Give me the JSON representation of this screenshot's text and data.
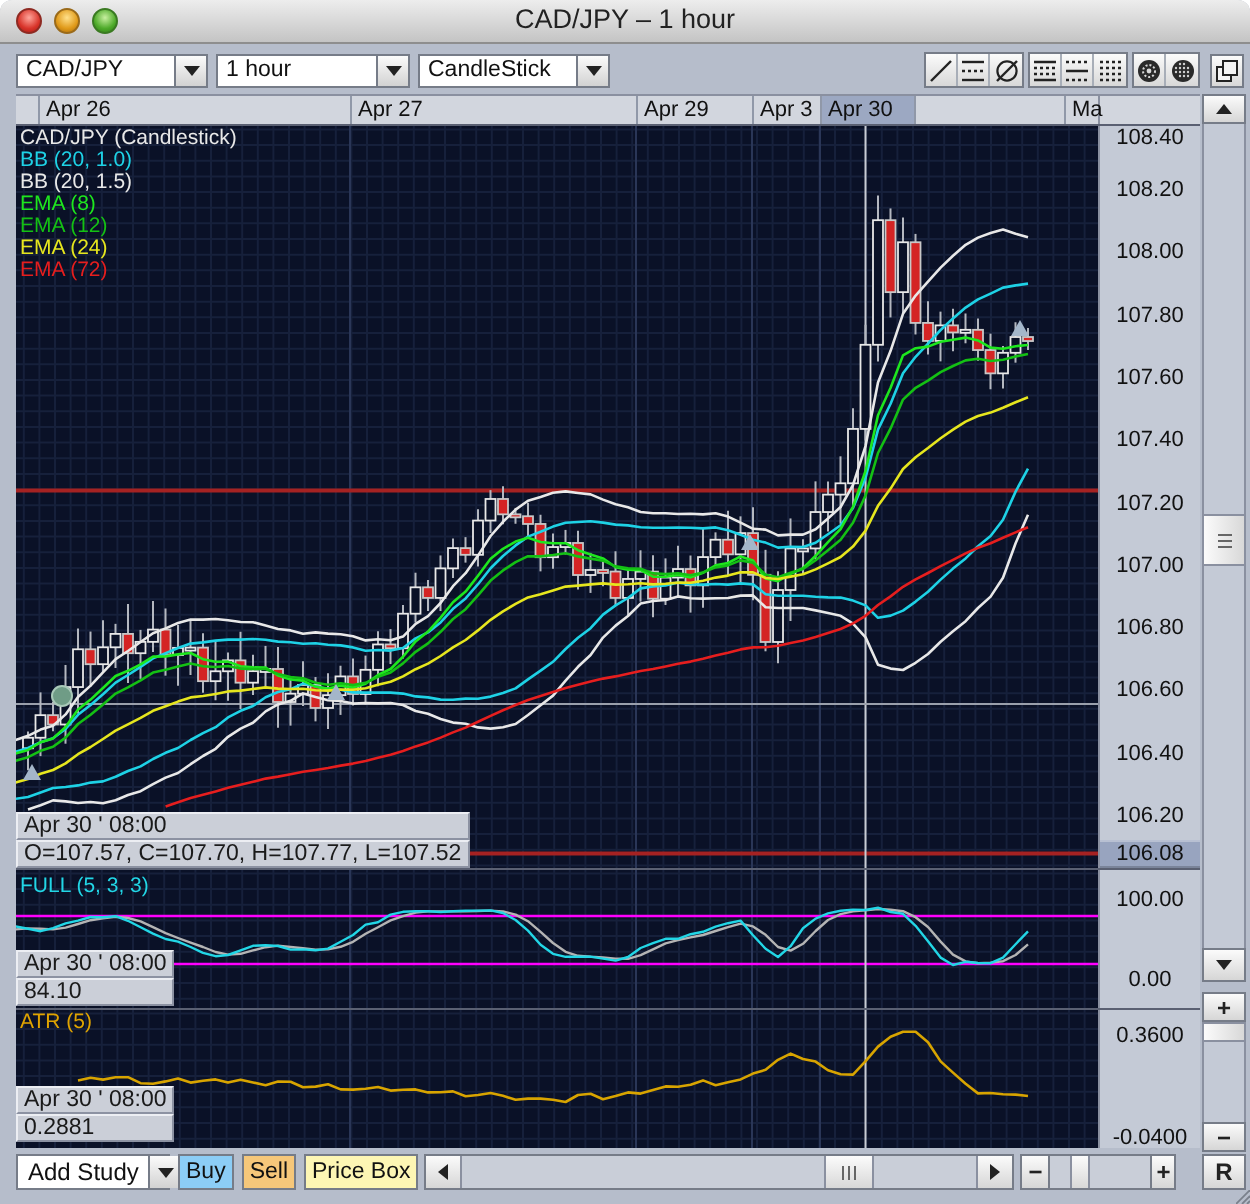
{
  "window": {
    "title": "CAD/JPY – 1 hour"
  },
  "toolbar": {
    "dropdowns": [
      {
        "value": "CAD/JPY"
      },
      {
        "value": "1 hour"
      },
      {
        "value": "CandleStick"
      }
    ]
  },
  "date_axis": {
    "labels": [
      {
        "text": "Apr 26",
        "highlighted": false
      },
      {
        "text": "Apr 27",
        "highlighted": false
      },
      {
        "text": "Apr 29",
        "highlighted": false
      },
      {
        "text": "Apr 3",
        "highlighted": false
      },
      {
        "text": "Apr 30",
        "highlighted": true
      },
      {
        "text": "Ma",
        "highlighted": false
      }
    ]
  },
  "price_panel": {
    "legend": [
      {
        "label": "CAD/JPY (Candlestick)",
        "kind": "candles",
        "color": "#e8e8e8"
      },
      {
        "label": "BB (20, 1.0)",
        "kind": "bands",
        "color": "#1ed2e6"
      },
      {
        "label": "BB (20, 1.5)",
        "kind": "bands",
        "color": "#e8e8e8"
      },
      {
        "label": "EMA (8)",
        "kind": "ema",
        "color": "#1ee61e"
      },
      {
        "label": "EMA (12)",
        "kind": "ema",
        "color": "#14c014"
      },
      {
        "label": "EMA (24)",
        "kind": "ema",
        "color": "#e6e61e"
      },
      {
        "label": "EMA (72)",
        "kind": "ema",
        "color": "#e61e1e"
      }
    ],
    "axis_ticks": [
      "108.40",
      "108.20",
      "108.00",
      "107.80",
      "107.60",
      "107.40",
      "107.20",
      "107.00",
      "106.80",
      "106.60",
      "106.40",
      "106.20"
    ],
    "current_price": "106.08",
    "tooltip": {
      "time": "Apr 30 ' 08:00",
      "values": "O=107.57, C=107.70, H=107.77, L=107.52"
    }
  },
  "stochastic_panel": {
    "title": "FULL (5, 3, 3)",
    "axis_ticks": [
      "100.00",
      "0.00"
    ],
    "tooltip": {
      "time": "Apr 30 ' 08:00",
      "value": "84.10"
    }
  },
  "atr_panel": {
    "title": "ATR (5)",
    "axis_ticks": [
      "0.3600",
      "-0.0400"
    ],
    "tooltip": {
      "time": "Apr 30 ' 08:00",
      "value": "0.2881"
    }
  },
  "bottom_bar": {
    "study_dropdown": {
      "value": "Add Study"
    },
    "buttons": [
      {
        "label": "Buy",
        "color": "#8ccdf6"
      },
      {
        "label": "Sell",
        "color": "#f6c77a"
      },
      {
        "label": "Price Box",
        "color": "#fdf6b4"
      }
    ],
    "zoom_out": "−",
    "zoom_slider": {
      "level": 0.24
    },
    "zoom_in": "+"
  },
  "side_bar": {
    "zoom_in": "+",
    "scale_slider": {
      "level": 1
    },
    "zoom_out": "−",
    "reset": "R"
  }
}
